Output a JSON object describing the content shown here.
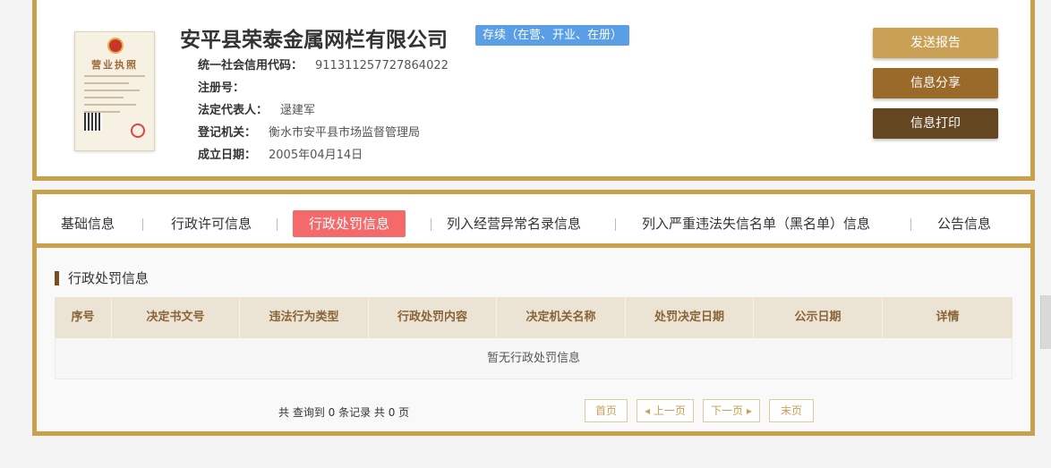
{
  "company": {
    "name": "安平县荣泰金属网栏有限公司",
    "status": "存续（在营、开业、在册）",
    "license_image": {
      "title": "营业执照"
    },
    "fields": [
      {
        "label": "统一社会信用代码：",
        "value": "911311257727864022"
      },
      {
        "label": "注册号：",
        "value": ""
      },
      {
        "label": "法定代表人：",
        "value": "逯建军"
      },
      {
        "label": "登记机关：",
        "value": "衡水市安平县市场监督管理局"
      },
      {
        "label": "成立日期：",
        "value": "2005年04月14日"
      }
    ]
  },
  "actions": {
    "report": "发送报告",
    "share": "信息分享",
    "print": "信息打印"
  },
  "tabs": [
    {
      "label": "基础信息",
      "active": false
    },
    {
      "label": "行政许可信息",
      "active": false
    },
    {
      "label": "行政处罚信息",
      "active": true
    },
    {
      "label": "列入经营异常名录信息",
      "active": false
    },
    {
      "label": "列入严重违法失信名单（黑名单）信息",
      "active": false
    },
    {
      "label": "公告信息",
      "active": false
    }
  ],
  "section": {
    "title": "行政处罚信息",
    "columns": [
      "序号",
      "决定书文号",
      "违法行为类型",
      "行政处罚内容",
      "决定机关名称",
      "处罚决定日期",
      "公示日期",
      "详情"
    ],
    "empty_text": "暂无行政处罚信息"
  },
  "pagination": {
    "summary": "共 查询到 0 条记录 共 0 页",
    "first": "首页",
    "prev": "上一页",
    "next": "下一页",
    "last": "末页",
    "prev_icon": "◂",
    "next_icon": "▸"
  },
  "colors": {
    "border_gold": "#c9a14c",
    "status_blue": "#5a9ee6",
    "active_tab": "#f46a6a",
    "btn_report": "#c9a054",
    "btn_share": "#9a6a2b",
    "btn_print": "#644620"
  }
}
